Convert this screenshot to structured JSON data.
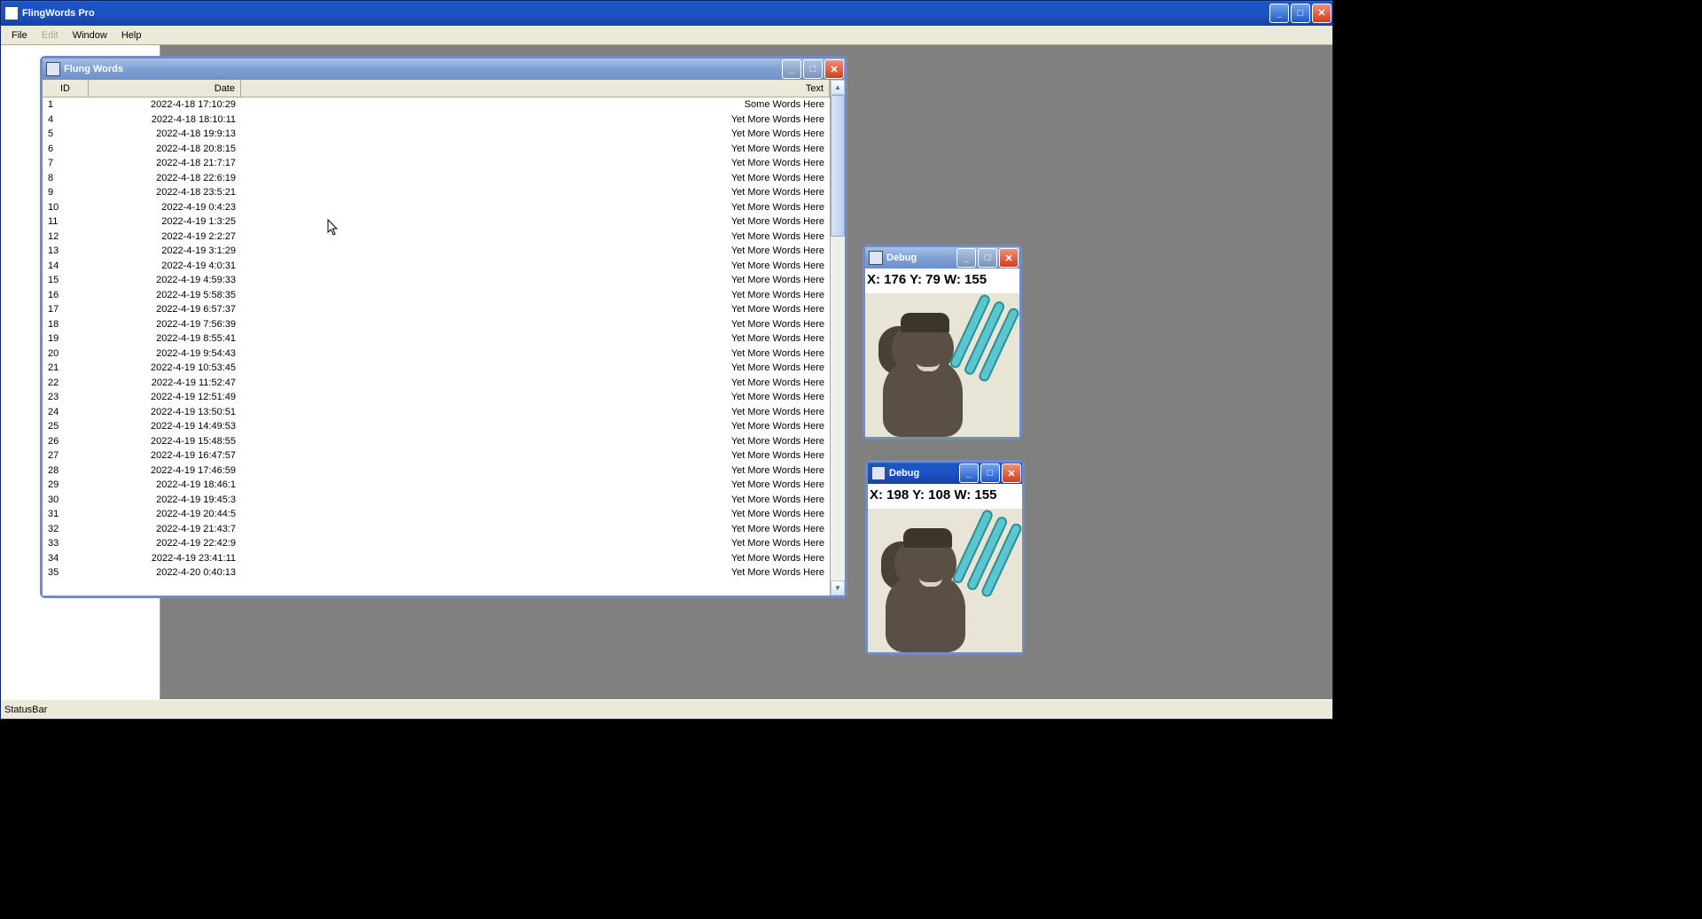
{
  "app": {
    "title": "FlingWords Pro",
    "menu": {
      "file": "File",
      "edit": "Edit",
      "window": "Window",
      "help": "Help"
    },
    "status": "StatusBar"
  },
  "flung": {
    "title": "Flung Words",
    "headers": {
      "id": "ID",
      "date": "Date",
      "text": "Text"
    },
    "rows": [
      {
        "id": "1",
        "date": "2022-4-18 17:10:29",
        "text": "Some Words Here"
      },
      {
        "id": "4",
        "date": "2022-4-18 18:10:11",
        "text": "Yet More Words Here"
      },
      {
        "id": "5",
        "date": "2022-4-18 19:9:13",
        "text": "Yet More Words Here"
      },
      {
        "id": "6",
        "date": "2022-4-18 20:8:15",
        "text": "Yet More Words Here"
      },
      {
        "id": "7",
        "date": "2022-4-18 21:7:17",
        "text": "Yet More Words Here"
      },
      {
        "id": "8",
        "date": "2022-4-18 22:6:19",
        "text": "Yet More Words Here"
      },
      {
        "id": "9",
        "date": "2022-4-18 23:5:21",
        "text": "Yet More Words Here"
      },
      {
        "id": "10",
        "date": "2022-4-19 0:4:23",
        "text": "Yet More Words Here"
      },
      {
        "id": "11",
        "date": "2022-4-19 1:3:25",
        "text": "Yet More Words Here"
      },
      {
        "id": "12",
        "date": "2022-4-19 2:2:27",
        "text": "Yet More Words Here"
      },
      {
        "id": "13",
        "date": "2022-4-19 3:1:29",
        "text": "Yet More Words Here"
      },
      {
        "id": "14",
        "date": "2022-4-19 4:0:31",
        "text": "Yet More Words Here"
      },
      {
        "id": "15",
        "date": "2022-4-19 4:59:33",
        "text": "Yet More Words Here"
      },
      {
        "id": "16",
        "date": "2022-4-19 5:58:35",
        "text": "Yet More Words Here"
      },
      {
        "id": "17",
        "date": "2022-4-19 6:57:37",
        "text": "Yet More Words Here"
      },
      {
        "id": "18",
        "date": "2022-4-19 7:56:39",
        "text": "Yet More Words Here"
      },
      {
        "id": "19",
        "date": "2022-4-19 8:55:41",
        "text": "Yet More Words Here"
      },
      {
        "id": "20",
        "date": "2022-4-19 9:54:43",
        "text": "Yet More Words Here"
      },
      {
        "id": "21",
        "date": "2022-4-19 10:53:45",
        "text": "Yet More Words Here"
      },
      {
        "id": "22",
        "date": "2022-4-19 11:52:47",
        "text": "Yet More Words Here"
      },
      {
        "id": "23",
        "date": "2022-4-19 12:51:49",
        "text": "Yet More Words Here"
      },
      {
        "id": "24",
        "date": "2022-4-19 13:50:51",
        "text": "Yet More Words Here"
      },
      {
        "id": "25",
        "date": "2022-4-19 14:49:53",
        "text": "Yet More Words Here"
      },
      {
        "id": "26",
        "date": "2022-4-19 15:48:55",
        "text": "Yet More Words Here"
      },
      {
        "id": "27",
        "date": "2022-4-19 16:47:57",
        "text": "Yet More Words Here"
      },
      {
        "id": "28",
        "date": "2022-4-19 17:46:59",
        "text": "Yet More Words Here"
      },
      {
        "id": "29",
        "date": "2022-4-19 18:46:1",
        "text": "Yet More Words Here"
      },
      {
        "id": "30",
        "date": "2022-4-19 19:45:3",
        "text": "Yet More Words Here"
      },
      {
        "id": "31",
        "date": "2022-4-19 20:44:5",
        "text": "Yet More Words Here"
      },
      {
        "id": "32",
        "date": "2022-4-19 21:43:7",
        "text": "Yet More Words Here"
      },
      {
        "id": "33",
        "date": "2022-4-19 22:42:9",
        "text": "Yet More Words Here"
      },
      {
        "id": "34",
        "date": "2022-4-19 23:41:11",
        "text": "Yet More Words Here"
      },
      {
        "id": "35",
        "date": "2022-4-20 0:40:13",
        "text": "Yet More Words Here"
      }
    ]
  },
  "debug1": {
    "title": "Debug",
    "coords": "X: 176 Y: 79 W: 155"
  },
  "debug2": {
    "title": "Debug",
    "coords": "X: 198 Y: 108 W: 155"
  }
}
